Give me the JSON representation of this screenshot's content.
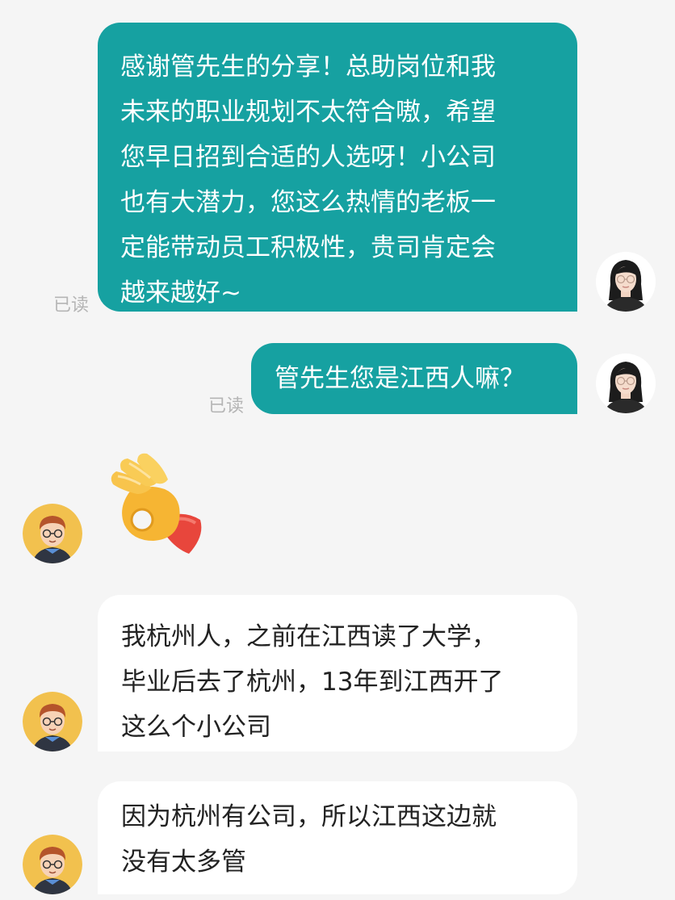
{
  "messages": [
    {
      "id": "m1",
      "direction": "outgoing",
      "lines": [
        "感谢管先生的分享！总助岗位和我",
        "未来的职业规划不太符合嗷，希望",
        "您早日招到合适的人选呀！小公司",
        "也有大潜力，您这么热情的老板一",
        "定能带动员工积极性，贵司肯定会",
        "越来越好~"
      ],
      "status": "已读"
    },
    {
      "id": "m2",
      "direction": "outgoing",
      "lines": [
        "管先生您是江西人嘛？"
      ],
      "status": "已读"
    },
    {
      "id": "m3",
      "direction": "incoming",
      "emoji": "ok-hand-icon"
    },
    {
      "id": "m4",
      "direction": "incoming",
      "lines": [
        "我杭州人，之前在江西读了大学，",
        "毕业后去了杭州，13年到江西开了",
        "这么个小公司"
      ]
    },
    {
      "id": "m5",
      "direction": "incoming",
      "lines": [
        "因为杭州有公司，所以江西这边就",
        "没有太多管"
      ]
    }
  ],
  "colors": {
    "background": "#f5f5f5",
    "outgoing_bubble": "#16a1a1",
    "incoming_bubble": "#ffffff",
    "read_status": "#b5b5b5"
  },
  "avatars": {
    "me": "female-avatar-icon",
    "contact": "male-cartoon-avatar-icon"
  }
}
